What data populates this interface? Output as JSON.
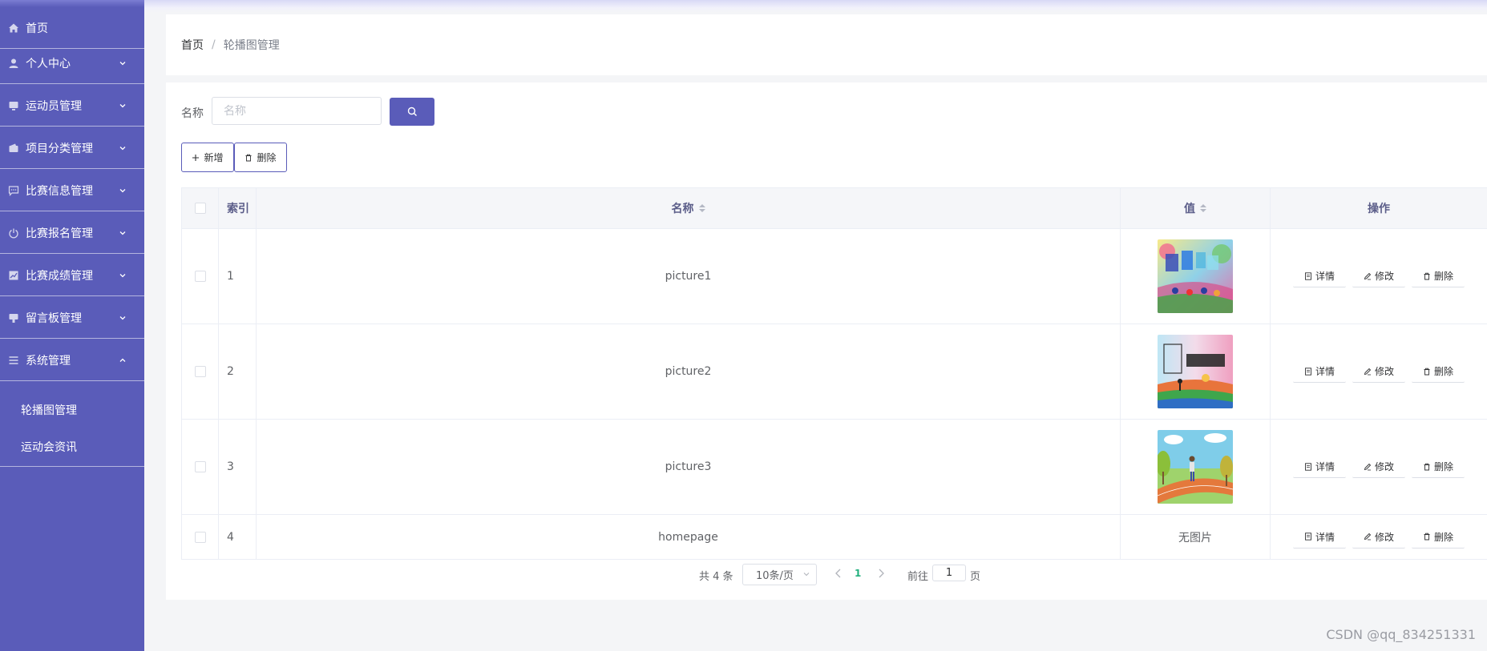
{
  "sidebar": {
    "items": [
      {
        "label": "首页",
        "icon": "home-icon"
      },
      {
        "label": "个人中心",
        "icon": "user-icon"
      },
      {
        "label": "运动员管理",
        "icon": "monitor-icon"
      },
      {
        "label": "项目分类管理",
        "icon": "wallet-icon"
      },
      {
        "label": "比赛信息管理",
        "icon": "chat-icon"
      },
      {
        "label": "比赛报名管理",
        "icon": "power-icon"
      },
      {
        "label": "比赛成绩管理",
        "icon": "chart-icon"
      },
      {
        "label": "留言板管理",
        "icon": "notice-icon"
      },
      {
        "label": "系统管理",
        "icon": "list-icon"
      }
    ],
    "sub_items": [
      {
        "label": "轮播图管理"
      },
      {
        "label": "运动会资讯"
      }
    ]
  },
  "breadcrumb": {
    "home": "首页",
    "separator": "/",
    "current": "轮播图管理"
  },
  "search": {
    "label": "名称",
    "placeholder": "名称",
    "value": ""
  },
  "toolbar": {
    "add_label": "新增",
    "delete_label": "删除"
  },
  "table": {
    "headers": {
      "index": "索引",
      "name": "名称",
      "value": "值",
      "ops": "操作"
    },
    "rows": [
      {
        "index": "1",
        "name": "picture1",
        "value": "",
        "image": "colorful-sports-banner"
      },
      {
        "index": "2",
        "name": "picture2",
        "value": "",
        "image": "sports-meet-cheer-banner"
      },
      {
        "index": "3",
        "name": "picture3",
        "value": "",
        "image": "runner-on-track"
      },
      {
        "index": "4",
        "name": "homepage",
        "value": "无图片",
        "image": ""
      }
    ],
    "op_labels": {
      "detail": "详情",
      "edit": "修改",
      "delete": "删除"
    }
  },
  "pagination": {
    "total": "共 4 条",
    "page_size": "10条/页",
    "current_page": "1",
    "goto_prefix": "前往",
    "goto_value": "1",
    "goto_suffix": "页"
  },
  "watermark": "CSDN @qq_834251331",
  "colors": {
    "primary": "#5a5cb9",
    "active_page": "#22b07d"
  }
}
